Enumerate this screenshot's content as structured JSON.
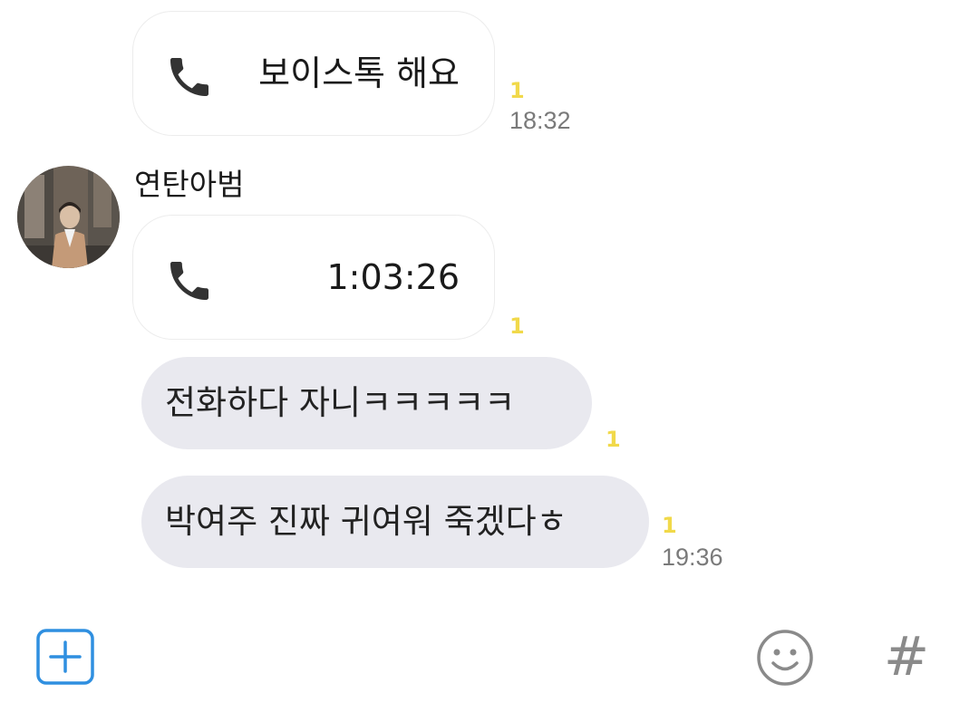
{
  "messages": [
    {
      "type": "call",
      "icon": "phone-icon",
      "text": "보이스톡 해요",
      "unread": "1",
      "time": "18:32"
    },
    {
      "type": "call",
      "sender": "연탄아범",
      "icon": "phone-icon",
      "text": "1:03:26",
      "unread": "1"
    },
    {
      "type": "text",
      "text": "전화하다 자니ㅋㅋㅋㅋㅋ",
      "unread": "1"
    },
    {
      "type": "text",
      "text": "박여주 진짜 귀여워 죽겠다ㅎ",
      "unread": "1",
      "time": "19:36"
    }
  ],
  "input_bar": {
    "plus_icon": "plus-square-icon",
    "emoji_icon": "smiley-icon",
    "hash_label": "#"
  },
  "colors": {
    "bubble_gray": "#e9e9ef",
    "unread_yellow": "#f1d94a",
    "accent_blue": "#2f8fe0"
  }
}
